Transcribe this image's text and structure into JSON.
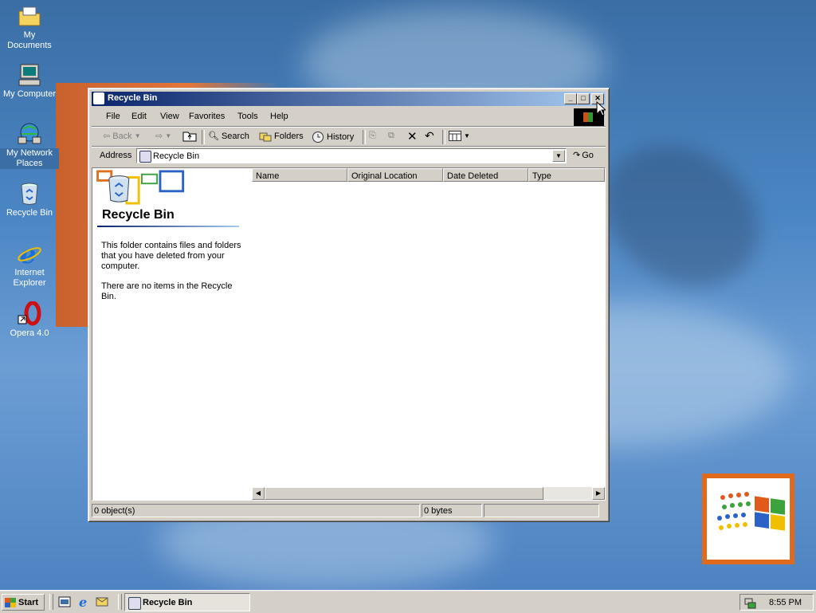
{
  "desktop": {
    "icons": [
      {
        "label": "My Documents",
        "icon": "folder-documents-icon"
      },
      {
        "label": "My Computer",
        "icon": "computer-icon"
      },
      {
        "label": "My Network Places",
        "icon": "network-icon"
      },
      {
        "label": "Recycle Bin",
        "icon": "recycle-bin-icon"
      },
      {
        "label": "Internet Explorer",
        "icon": "ie-icon"
      },
      {
        "label": "Opera 4.0",
        "icon": "opera-icon"
      }
    ]
  },
  "window": {
    "title": "Recycle Bin",
    "menu": [
      "File",
      "Edit",
      "View",
      "Favorites",
      "Tools",
      "Help"
    ],
    "toolbar": {
      "back": "Back",
      "search": "Search",
      "folders": "Folders",
      "history": "History"
    },
    "address": {
      "label": "Address",
      "value": "Recycle Bin",
      "go": "Go"
    },
    "info_panel": {
      "title": "Recycle Bin",
      "description": "This folder contains files and folders that you have deleted from your computer.",
      "empty_message": "There are no items in the Recycle Bin."
    },
    "columns": [
      "Name",
      "Original Location",
      "Date Deleted",
      "Type"
    ],
    "status": {
      "objects": "0 object(s)",
      "size": "0 bytes"
    }
  },
  "taskbar": {
    "start": "Start",
    "task": "Recycle Bin",
    "clock": "8:55 PM"
  },
  "colors": {
    "title_active_start": "#0a246a",
    "title_active_end": "#a6caf0",
    "face": "#d4d0c8",
    "desktop": "#3a6ea5"
  }
}
